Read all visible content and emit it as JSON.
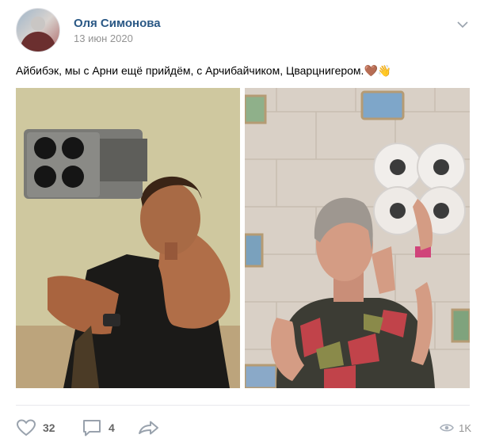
{
  "post": {
    "author": "Оля Симонова",
    "date": "13 июн 2020",
    "text": "Айбибэк, мы с Арни ещё прийдём, с Арчибайчиком, Цварцнигером.",
    "emojis": [
      "🤎",
      "👋"
    ]
  },
  "photos": [
    {
      "icon": "photo-man-with-launcher"
    },
    {
      "icon": "photo-woman-with-toilet-paper"
    }
  ],
  "actions": {
    "likes": "32",
    "comments": "4",
    "views": "1K"
  },
  "colors": {
    "author": "#2a5885",
    "muted": "#939393",
    "icon": "#99a2ad",
    "divider": "#e7e8ec"
  }
}
